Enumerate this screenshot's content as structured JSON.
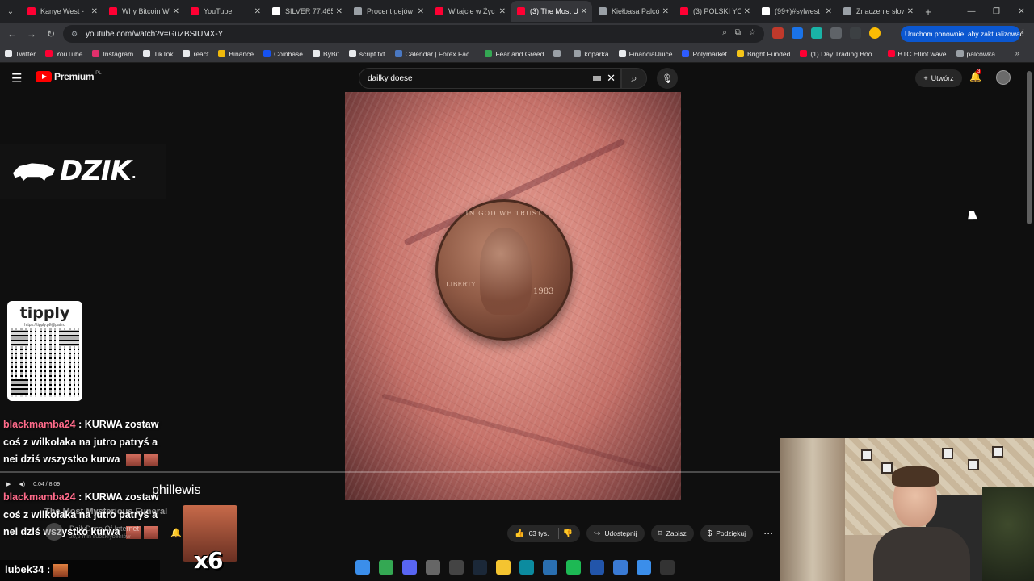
{
  "browser": {
    "tabs": [
      {
        "label": "Kanye West - ",
        "fav_color": "#ff0033",
        "active": false
      },
      {
        "label": "Why Bitcoin W",
        "fav_color": "#ff0033",
        "active": false
      },
      {
        "label": "YouTube",
        "fav_color": "#ff0033",
        "active": false
      },
      {
        "label": "SILVER 77.465",
        "fav_color": "#ffffff",
        "active": false
      },
      {
        "label": "Procent gejów",
        "fav_color": "#9aa0a6",
        "active": false
      },
      {
        "label": "Witajcie w Życ",
        "fav_color": "#ff0033",
        "active": false
      },
      {
        "label": "(3) The Most U",
        "fav_color": "#ff0033",
        "active": true
      },
      {
        "label": "Kiełbasa Palcó",
        "fav_color": "#9aa0a6",
        "active": false
      },
      {
        "label": "(3) POLSKI YOU",
        "fav_color": "#ff0033",
        "active": false
      },
      {
        "label": "(99+)#sylwest",
        "fav_color": "#ffffff",
        "active": false
      },
      {
        "label": "Znaczenie słow",
        "fav_color": "#9aa0a6",
        "active": false
      }
    ],
    "url": "youtube.com/watch?v=GuZBSIUMX-Y",
    "update_button": "Uruchom ponownie, aby zaktualizować",
    "bookmarks": [
      {
        "label": "Twitter",
        "color": "#e8eaed"
      },
      {
        "label": "YouTube",
        "color": "#ff0033"
      },
      {
        "label": "Instagram",
        "color": "#e1306c"
      },
      {
        "label": "TikTok",
        "color": "#e8eaed"
      },
      {
        "label": "react",
        "color": "#e8eaed"
      },
      {
        "label": "Binance",
        "color": "#f0b90b"
      },
      {
        "label": "Coinbase",
        "color": "#1652f0"
      },
      {
        "label": "ByBit",
        "color": "#e8eaed"
      },
      {
        "label": "script.txt",
        "color": "#e8eaed"
      },
      {
        "label": "Calendar | Forex Fac...",
        "color": "#4a78c2"
      },
      {
        "label": "Fear and Greed",
        "color": "#34a853"
      },
      {
        "label": "",
        "color": "#9aa0a6"
      },
      {
        "label": "koparka",
        "color": "#9aa0a6"
      },
      {
        "label": "FinancialJuice",
        "color": "#e8eaed"
      },
      {
        "label": "Polymarket",
        "color": "#2e5cff"
      },
      {
        "label": "Bright Funded",
        "color": "#f5c518"
      },
      {
        "label": "(1) Day Trading Boo...",
        "color": "#ff0033"
      },
      {
        "label": "BTC Elliot wave",
        "color": "#ff0033"
      },
      {
        "label": "palcówka",
        "color": "#9aa0a6"
      }
    ]
  },
  "youtube": {
    "brand": "Premium",
    "country": "PL",
    "search_query": "dailky doese",
    "create_label": "Utwórz",
    "notif_count": "3"
  },
  "video": {
    "coin_legend": "IN GOD WE TRUST",
    "coin_word": "LIBERTY",
    "coin_year": "1983"
  },
  "overlay": {
    "dzik": "DZIK",
    "tipply": "tipply",
    "tipply_url": "https://tipply.pl/@patiro",
    "chat": [
      {
        "user": "blackmamba24",
        "message": " : KURWA zostaw coś z wilkołaka na jutro patryś a nei dziś wszystko kurwa"
      },
      {
        "user": "blackmamba24",
        "message": " : KURWA zostaw coś z wilkołaka na jutro patryś a nei dziś wszystko kurwa"
      }
    ],
    "player_time": "0:04 / 8:09",
    "mention": "phillewis",
    "ghost_title": "The Most Mysterious Funeral",
    "ghost_channel": "DailyDose Of Internet",
    "ghost_subs": "20,5 mln subskrybentów",
    "multiplier": "x6",
    "bottom_user": "lubek34 :"
  },
  "actions": {
    "likes": "63 tys.",
    "share": "Udostępnij",
    "save": "Zapisz",
    "thanks": "Podziękuj"
  },
  "taskbar": [
    {
      "icon": "windows-icon",
      "color": "#3b8eea"
    },
    {
      "icon": "chrome-icon",
      "color": "#34a853"
    },
    {
      "icon": "discord-icon",
      "color": "#5865f2"
    },
    {
      "icon": "app-icon",
      "color": "#666666"
    },
    {
      "icon": "obs-icon",
      "color": "#444444"
    },
    {
      "icon": "steam-icon",
      "color": "#1b2838"
    },
    {
      "icon": "folder-icon",
      "color": "#f4c430"
    },
    {
      "icon": "edge-icon",
      "color": "#0c8b9f"
    },
    {
      "icon": "tool-icon",
      "color": "#2a6fb0"
    },
    {
      "icon": "spotify-icon",
      "color": "#1db954"
    },
    {
      "icon": "app2-icon",
      "color": "#2255aa"
    },
    {
      "icon": "notepad-icon",
      "color": "#3a7bd5"
    },
    {
      "icon": "photos-icon",
      "color": "#3b8eea"
    },
    {
      "icon": "terminal-icon",
      "color": "#333333"
    }
  ]
}
